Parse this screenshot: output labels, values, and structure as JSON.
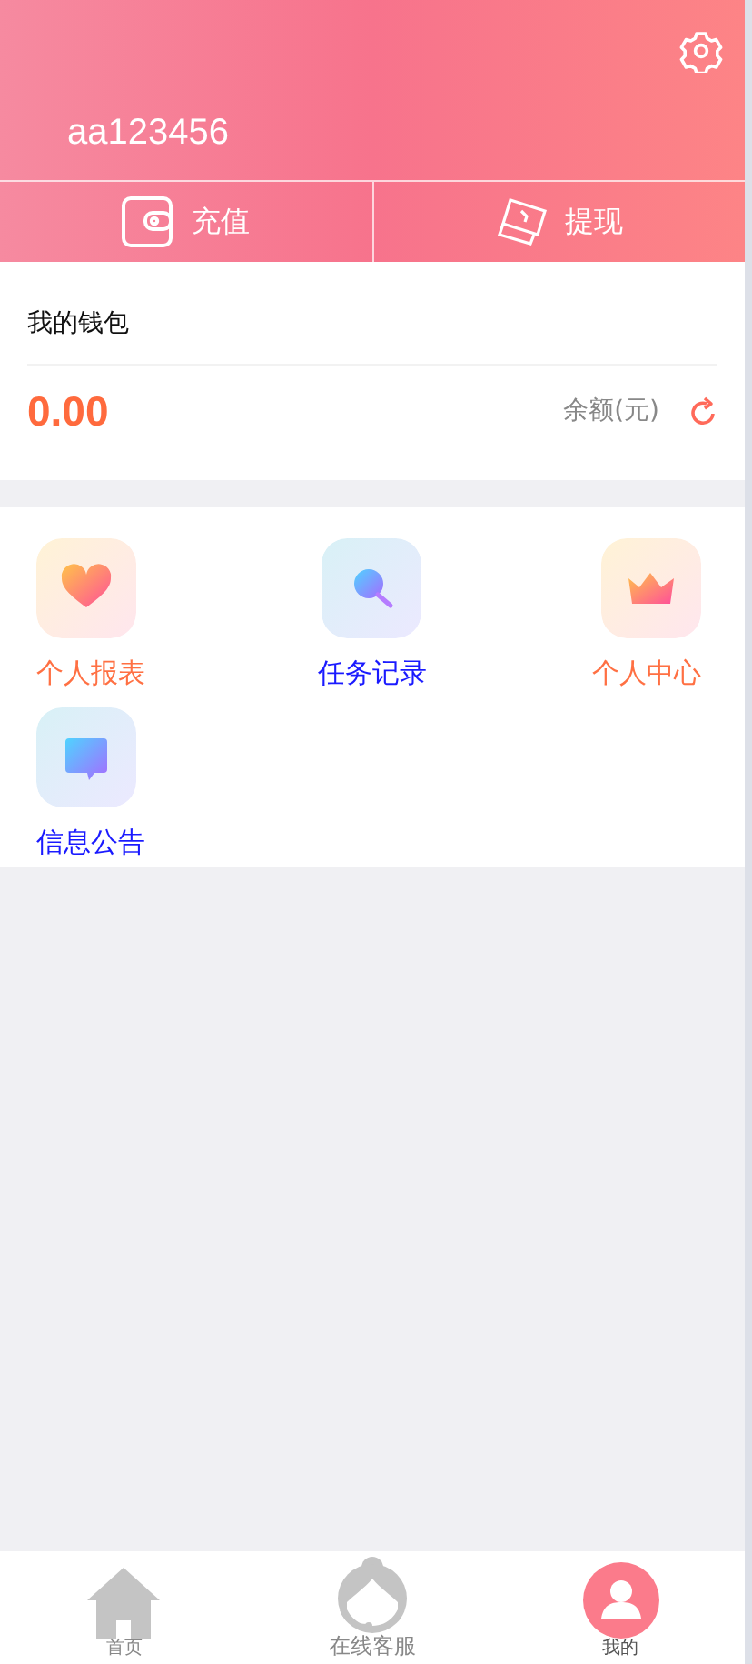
{
  "header": {
    "username": "aa123456"
  },
  "actions": [
    {
      "kind": "recharge",
      "label": "充值"
    },
    {
      "kind": "withdraw",
      "label": "提现"
    }
  ],
  "wallet": {
    "title": "我的钱包",
    "amount": "0.00",
    "balance_label": "余额(元)"
  },
  "menu": [
    {
      "kind": "heart",
      "label": "个人报表",
      "color": "#ff7043"
    },
    {
      "kind": "search",
      "label": "任务记录",
      "color": "#1a1aff"
    },
    {
      "kind": "crown",
      "label": "个人中心",
      "color": "#ff7043"
    },
    {
      "kind": "message",
      "label": "信息公告",
      "color": "#1a1aff"
    }
  ],
  "bottom_nav": [
    {
      "kind": "home",
      "label": "首页",
      "selected": false
    },
    {
      "kind": "service",
      "label": "在线客服",
      "selected": false
    },
    {
      "kind": "profile",
      "label": "我的",
      "selected": true
    }
  ]
}
